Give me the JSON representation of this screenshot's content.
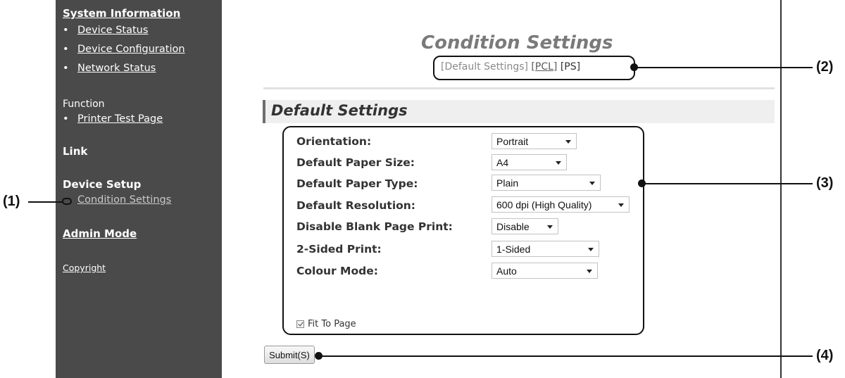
{
  "sidebar": {
    "system_information": "System Information",
    "device_status": "Device Status",
    "device_configuration": "Device Configuration",
    "network_status": "Network Status",
    "function_heading": "Function",
    "printer_test_page": "Printer Test Page",
    "link_heading": "Link",
    "device_setup_heading": "Device Setup",
    "condition_settings": "Condition Settings",
    "admin_mode": "Admin Mode",
    "copyright": "Copyright",
    "bullet": "•"
  },
  "main": {
    "title": "Condition Settings",
    "tabs": {
      "open": "[",
      "default_settings": "Default Settings",
      "mid": "] ",
      "pcl": "[PCL]",
      "space": " ",
      "ps": "[PS]"
    },
    "section_title": "Default Settings",
    "fields": [
      {
        "label": "Orientation:",
        "value": "Portrait"
      },
      {
        "label": "Default Paper Size:",
        "value": "A4"
      },
      {
        "label": "Default Paper Type:",
        "value": "Plain"
      },
      {
        "label": "Default Resolution:",
        "value": "600 dpi (High Quality)"
      },
      {
        "label": "Disable Blank Page Print:",
        "value": "Disable"
      },
      {
        "label": "2-Sided Print:",
        "value": "1-Sided"
      },
      {
        "label": "Colour Mode:",
        "value": "Auto"
      }
    ],
    "fit_to_page": {
      "label": "Fit To Page",
      "checked": true
    },
    "submit": "Submit(S)"
  },
  "callouts": {
    "c1": "(1)",
    "c2": "(2)",
    "c3": "(3)",
    "c4": "(4)"
  },
  "colors": {
    "sidebar_bg": "#4a4a4a",
    "title_gray": "#7a7a7a",
    "section_bg": "#efefef"
  }
}
